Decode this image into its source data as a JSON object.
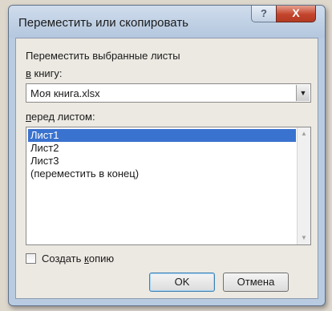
{
  "dialog": {
    "title": "Переместить или скопировать",
    "help_label": "?",
    "close_label": "X"
  },
  "move_label": "Переместить выбранные листы",
  "book": {
    "label_accel": "в",
    "label_rest": " книгу:",
    "value": "Моя книга.xlsx"
  },
  "before": {
    "label_accel": "п",
    "label_rest": "еред листом:",
    "items": [
      "Лист1",
      "Лист2",
      "Лист3",
      "(переместить в конец)"
    ],
    "selected_index": 0
  },
  "copy": {
    "label_pre": "Создать ",
    "label_accel": "к",
    "label_post": "опию",
    "checked": false
  },
  "buttons": {
    "ok": "OK",
    "cancel": "Отмена"
  }
}
